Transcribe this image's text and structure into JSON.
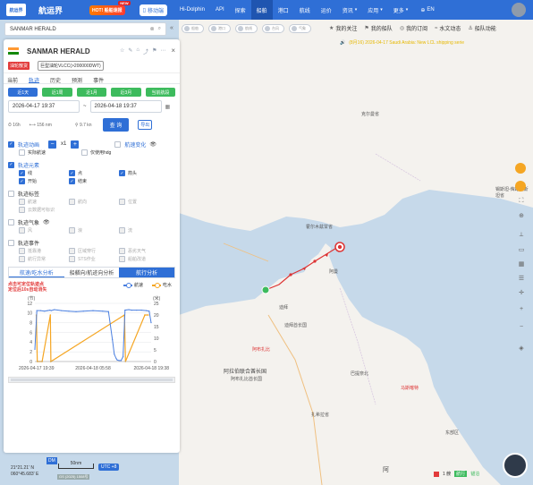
{
  "topbar": {
    "logo_text": "航运界",
    "brand": "航运界",
    "hot_label": "HOT! 船舶速报",
    "new_tag": "NEW",
    "mobile_label": "移动端",
    "nav": [
      {
        "label": "Hi-Dolphin",
        "active": false,
        "dropdown": false
      },
      {
        "label": "API",
        "active": false,
        "dropdown": false
      },
      {
        "label": "探索",
        "active": false,
        "dropdown": false
      },
      {
        "label": "船舶",
        "active": true,
        "dropdown": false
      },
      {
        "label": "港口",
        "active": false,
        "dropdown": false
      },
      {
        "label": "航线",
        "active": false,
        "dropdown": false
      },
      {
        "label": "运价",
        "active": false,
        "dropdown": false
      },
      {
        "label": "资讯",
        "active": false,
        "dropdown": true
      },
      {
        "label": "应用",
        "active": false,
        "dropdown": true
      },
      {
        "label": "更多",
        "active": false,
        "dropdown": true
      }
    ],
    "lang": "EN"
  },
  "search": {
    "value": "SANMAR HERALD"
  },
  "layer_toggles": [
    "船舶",
    "港口",
    "航线",
    "台风",
    "气象"
  ],
  "quick_links": [
    {
      "label": "我的关注",
      "icon": "star-icon"
    },
    {
      "label": "我的船队",
      "icon": "fleet-icon"
    },
    {
      "label": "我的订阅",
      "icon": "subscribe-icon"
    },
    {
      "label": "水文动态",
      "icon": "water-icon"
    },
    {
      "label": "船队动能",
      "icon": "fleet-power-icon"
    }
  ],
  "notice": "(8月16) 2026-04-17 Saudi Arabia: New LCL shipping serie",
  "ship": {
    "name": "SANMAR HERALD",
    "flag_colors": [
      "#ff9933",
      "#ffffff",
      "#138808"
    ],
    "tag_red": "油轮散货",
    "tag_outline": "巨型油轮VLCC(>200000DWT)"
  },
  "detail_tabs": [
    "当前",
    "轨迹",
    "历史",
    "预测",
    "事件"
  ],
  "active_detail_tab": "轨迹",
  "range_buttons": [
    "近1天",
    "近1周",
    "近1月",
    "近3月",
    "当前航段"
  ],
  "date_from": "2026-04-17 19:37",
  "date_to": "2026-04-18 19:37",
  "date_sep": "~",
  "stats": {
    "duration": "16h",
    "distance": "156 nm",
    "speed": "9.7 kn",
    "query_label": "查 询",
    "export_label": "导出"
  },
  "track_animation": {
    "label": "轨迹动画",
    "multiplier": "x1",
    "speed_change_label": "航速变化"
  },
  "animation_options": [
    "实际航速",
    "仅使用hdg"
  ],
  "track_elements": {
    "label": "轨迹元素",
    "items": [
      "线",
      "点",
      "箭头",
      "开始",
      "结束"
    ]
  },
  "track_label_section": {
    "label": "轨迹标签",
    "items": [
      "航速",
      "航向",
      "位置",
      "云数据可标识"
    ]
  },
  "track_weather": {
    "label": "轨迹气象",
    "items": [
      "风",
      "浪",
      "流"
    ]
  },
  "track_events": {
    "label": "轨迹事件",
    "items": [
      "抵靠港",
      "区域穿行",
      "恶劣天气",
      "航行异常",
      "STS作业",
      "船舶改道"
    ]
  },
  "analysis_tabs": [
    "航速/吃水分析",
    "船艏向/航迹向分析",
    "航行分析"
  ],
  "chart_note": [
    "点击可定位轨迹点",
    "定位后10s自动消失"
  ],
  "chart_data": {
    "type": "line",
    "series": [
      {
        "name": "航速",
        "color": "#4a7fe0",
        "axis": "left",
        "x": [
          0,
          0.4,
          1.2,
          2.0,
          2.6,
          3.1,
          3.4,
          4.0,
          5.5,
          7.0,
          8.5,
          10.0,
          12.0,
          14.0,
          15.2,
          16.0,
          16.4,
          16.8,
          17.0,
          17.4,
          17.8,
          18.2,
          18.6,
          19.4,
          20.0,
          21.0,
          22.0,
          23.0,
          23.6,
          24.0
        ],
        "values": [
          2.5,
          10.5,
          10.5,
          10.4,
          10.5,
          10.6,
          10.5,
          10.7,
          10.5,
          10.4,
          10.3,
          10.4,
          10.5,
          10.4,
          10.3,
          4.5,
          1.5,
          0.6,
          0.3,
          0.2,
          0.2,
          1.0,
          10.6,
          10.7,
          10.6,
          10.6,
          10.6,
          10.5,
          10.4,
          8.0
        ]
      },
      {
        "name": "吃水",
        "color": "#f5a623",
        "axis": "right",
        "x": [
          0.3,
          0.5,
          1.5,
          3.2,
          3.3,
          18.5,
          18.7,
          22.7,
          23.4
        ],
        "values": [
          20,
          0,
          0,
          20,
          0,
          20,
          0,
          20,
          20
        ]
      }
    ],
    "left_axis": {
      "label": "(节)",
      "ticks": [
        0,
        2,
        4,
        6,
        8,
        10,
        12
      ]
    },
    "right_axis": {
      "label": "(米)",
      "ticks": [
        0,
        5,
        10,
        15,
        20,
        25
      ]
    },
    "x_labels": [
      "2026-04-17 19:39",
      "2026-04-18 05:58",
      "2026-04-18 19:38"
    ],
    "xlim": [
      0,
      24
    ],
    "ylim_left": [
      0,
      12
    ],
    "ylim_right": [
      0,
      25
    ],
    "grid": true
  },
  "map_labels": [
    {
      "text": "克尔曼省",
      "red": false
    },
    {
      "text": "霍尔木兹甘省",
      "red": false
    },
    {
      "text": "阿曼",
      "red": false
    },
    {
      "text": "迪拜",
      "red": false
    },
    {
      "text": "迪拜酋长国",
      "red": false
    },
    {
      "text": "阿布扎比",
      "red": true
    },
    {
      "text": "阿拉伯联合酋长国",
      "red": false
    },
    {
      "text": "阿布扎比酋长国",
      "red": false
    },
    {
      "text": "巴提奈北",
      "red": false
    },
    {
      "text": "马斯喀特",
      "red": true
    },
    {
      "text": "扎希拉省",
      "red": false
    },
    {
      "text": "东部区",
      "red": false
    },
    {
      "text": "锡斯坦-俾路支斯坦省",
      "red": false
    },
    {
      "text": "阿",
      "red": false
    }
  ],
  "bottom": {
    "coords_lat": "21°21.21' N",
    "coords_lon": "060°45.683' E",
    "dm_label": "DM",
    "scale_label": "50nm",
    "utc_label": "UTC +8",
    "copyright": "GS (2025) 1508号",
    "legend_flag": "1 艘",
    "legend_sailing": "航行",
    "legend_anchor": "锚泊"
  }
}
